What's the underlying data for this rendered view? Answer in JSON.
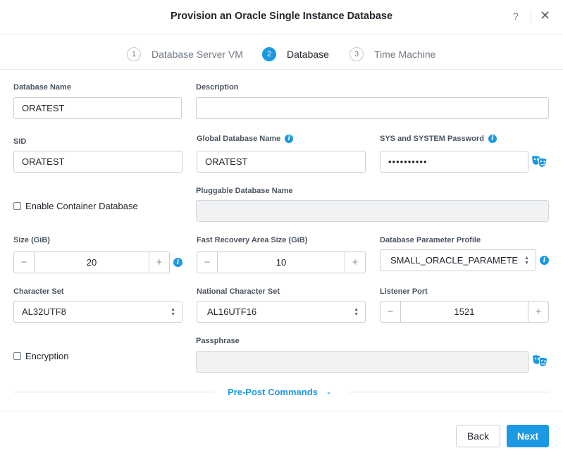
{
  "dialog": {
    "title": "Provision an Oracle Single Instance Database",
    "help": "?",
    "close": "✕"
  },
  "steps": [
    {
      "num": "1",
      "label": "Database Server VM",
      "active": false
    },
    {
      "num": "2",
      "label": "Database",
      "active": true
    },
    {
      "num": "3",
      "label": "Time Machine",
      "active": false
    }
  ],
  "form": {
    "db_name": {
      "label": "Database Name",
      "value": "ORATEST"
    },
    "description": {
      "label": "Description",
      "value": ""
    },
    "sid": {
      "label": "SID",
      "value": "ORATEST"
    },
    "global_db_name": {
      "label": "Global Database Name",
      "value": "ORATEST"
    },
    "sys_password": {
      "label": "SYS and SYSTEM Password",
      "value": "••••••••••"
    },
    "container_db": {
      "label": "Enable Container Database",
      "checked": false
    },
    "pluggable_db_name": {
      "label": "Pluggable Database Name",
      "value": ""
    },
    "size": {
      "label": "Size (GiB)",
      "value": "20"
    },
    "fra_size": {
      "label": "Fast Recovery Area Size (GiB)",
      "value": "10"
    },
    "param_profile": {
      "label": "Database Parameter Profile",
      "value": "SMALL_ORACLE_PARAMETE"
    },
    "charset": {
      "label": "Character Set",
      "value": "AL32UTF8"
    },
    "nchar_set": {
      "label": "National Character Set",
      "value": "AL16UTF16"
    },
    "listener_port": {
      "label": "Listener Port",
      "value": "1521"
    },
    "encryption": {
      "label": "Encryption",
      "checked": false
    },
    "passphrase": {
      "label": "Passphrase",
      "value": ""
    }
  },
  "pre_post": {
    "label": "Pre-Post Commands"
  },
  "footer": {
    "back": "Back",
    "next": "Next"
  },
  "colors": {
    "accent": "#1b99e3"
  },
  "icons": {
    "info": "i",
    "minus": "−",
    "plus": "+",
    "chevron": "⌄"
  }
}
